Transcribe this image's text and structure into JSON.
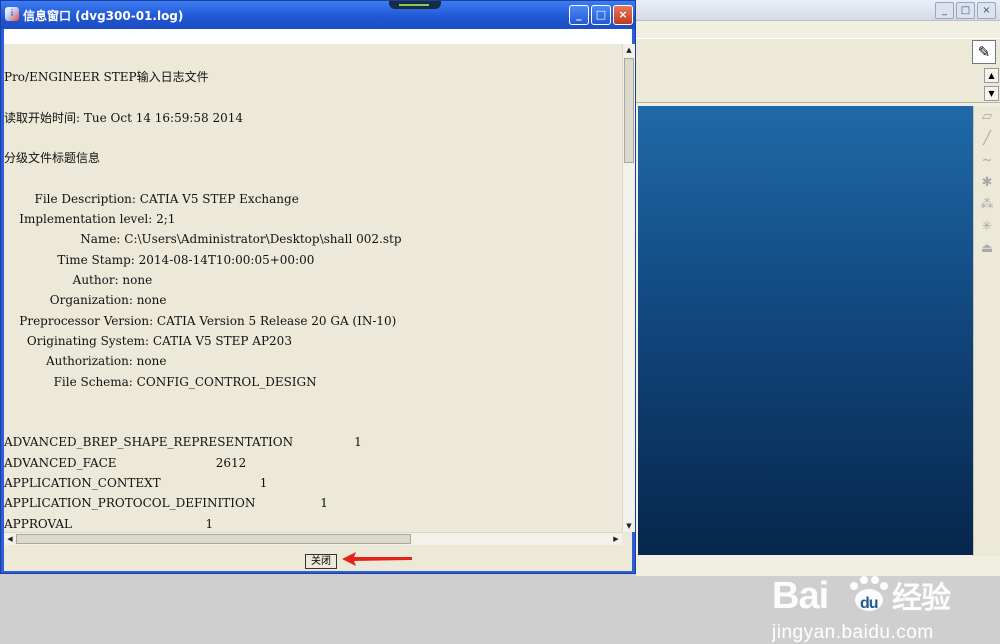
{
  "info_window": {
    "title": "信息窗口 (dvg300-01.log)",
    "close_button": "关闭",
    "lines": [
      "Pro/ENGINEER STEP输入日志文件",
      "读取开始时间: Tue Oct 14 16:59:58 2014",
      "分级文件标题信息",
      "        File Description: CATIA V5 STEP Exchange",
      "    Implementation level: 2;1",
      "                    Name: C:\\Users\\Administrator\\Desktop\\shall 002.stp",
      "              Time Stamp: 2014-08-14T10:00:05+00:00",
      "                  Author: none",
      "            Organization: none",
      "    Preprocessor Version: CATIA Version 5 Release 20 GA (IN-10)",
      "      Originating System: CATIA V5 STEP AP203",
      "           Authorization: none",
      "             File Schema: CONFIG_CONTROL_DESIGN",
      "ADVANCED_BREP_SHAPE_REPRESENTATION                1",
      "ADVANCED_FACE                          2612",
      "APPLICATION_CONTEXT                          1",
      "APPLICATION_PROTOCOL_DEFINITION                 1",
      "APPROVAL                                   1"
    ]
  },
  "watermark": {
    "logo": "Bai du 经验",
    "url": "jingyan.baidu.com"
  },
  "colors": {
    "titlebar": "#1f55d2",
    "viewport_top": "#1e6aa8",
    "viewport_bottom": "#06264c",
    "arrow": "#e0251b"
  }
}
